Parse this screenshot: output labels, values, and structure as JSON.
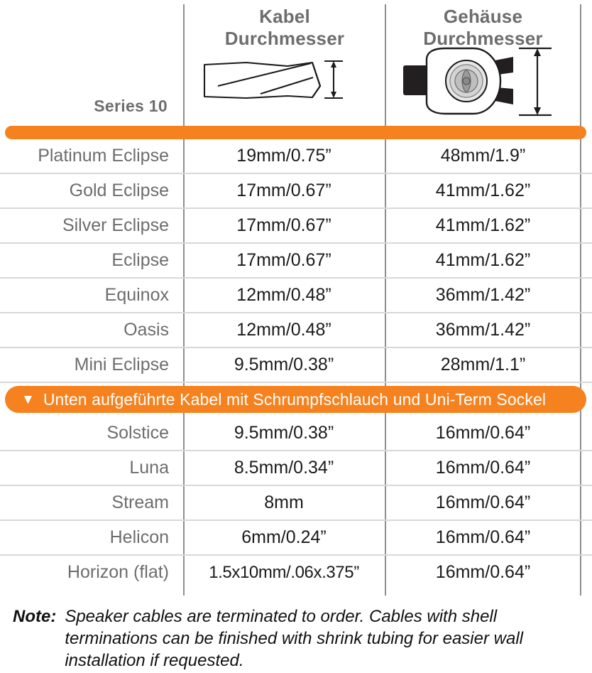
{
  "table": {
    "corner_label": "Series 10",
    "columns": [
      {
        "id": "name",
        "label": "Series 10"
      },
      {
        "id": "cable",
        "label": "Kabel Durchmesser",
        "line1": "Kabel",
        "line2": "Durchmesser",
        "icon": "cable-diameter-diagram"
      },
      {
        "id": "shell",
        "label": "Gehäuse Durchmesser",
        "line1": "Gehäuse",
        "line2": "Durchmesser",
        "icon": "shell-diameter-diagram"
      }
    ],
    "accent_color": "#F5821F",
    "rows": [
      {
        "name": "Platinum Eclipse",
        "cable": "19mm/0.75”",
        "shell": "48mm/1.9”"
      },
      {
        "name": "Gold Eclipse",
        "cable": "17mm/0.67”",
        "shell": "41mm/1.62”"
      },
      {
        "name": "Silver Eclipse",
        "cable": "17mm/0.67”",
        "shell": "41mm/1.62”"
      },
      {
        "name": "Eclipse",
        "cable": "17mm/0.67”",
        "shell": "41mm/1.62”"
      },
      {
        "name": "Equinox",
        "cable": "12mm/0.48”",
        "shell": "36mm/1.42”"
      },
      {
        "name": "Oasis",
        "cable": "12mm/0.48”",
        "shell": "36mm/1.42”"
      },
      {
        "name": "Mini Eclipse",
        "cable": "9.5mm/0.38”",
        "shell": "28mm/1.1”"
      }
    ],
    "section_banner": {
      "caret": "▼",
      "text": "Unten aufgeführte Kabel mit Schrumpfschlauch und Uni-Term Sockel"
    },
    "rows2": [
      {
        "name": "Solstice",
        "cable": "9.5mm/0.38”",
        "shell": "16mm/0.64”"
      },
      {
        "name": "Luna",
        "cable": "8.5mm/0.34”",
        "shell": "16mm/0.64”"
      },
      {
        "name": "Stream",
        "cable": "8mm",
        "shell": "16mm/0.64”"
      },
      {
        "name": "Helicon",
        "cable": "6mm/0.24”",
        "shell": "16mm/0.64”"
      },
      {
        "name": "Horizon (flat)",
        "cable": "1.5x10mm/.06x.375”",
        "shell": "16mm/0.64”"
      }
    ]
  },
  "note": {
    "label": "Note:",
    "text": "Speaker cables are terminated to order. Cables with shell terminations can be finished with shrink tubing for easier wall installation if requested."
  }
}
